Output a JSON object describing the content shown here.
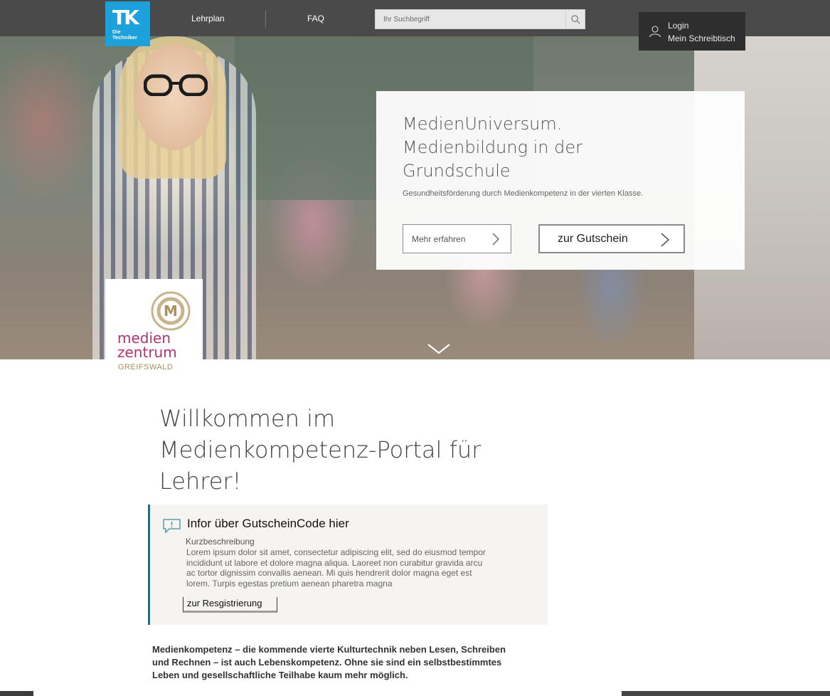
{
  "brand": {
    "logo_mark": "TK",
    "logo_text": "Die Techniker",
    "color": "#1da1dc"
  },
  "nav": {
    "links": [
      {
        "label": "Lehrplan"
      },
      {
        "label": "FAQ"
      }
    ],
    "search": {
      "placeholder": "Ihr Suchbegriff",
      "icon": "search-icon"
    },
    "login": {
      "line1": "Login",
      "line2": "Mein Schreibtisch",
      "icon": "user-icon"
    }
  },
  "hero": {
    "title": "MedienUniversum. Medienbildung in der Grundschule",
    "subtitle": "Gesundheitsförderung durch Medienkompetenz in der vierten Klasse.",
    "more_button": "Mehr erfahren",
    "voucher_button": "zur Gutschein",
    "scroll_icon": "chevron-down-icon"
  },
  "partner_logo": {
    "line1": "medien",
    "line2": "zentrum",
    "line3": "GREIFSWALD",
    "monogram": "M",
    "colors": {
      "text": "#b2336f",
      "gold": "#a9915f"
    }
  },
  "welcome": {
    "heading": "Willkommen im Medienkompetenz-Portal für Lehrer!"
  },
  "info": {
    "title": "Infor über GutscheinCode hier",
    "label": "Kurzbeschreibung",
    "text": "Lorem ipsum dolor sit amet, consectetur adipiscing elit, sed do eiusmod tempor incididunt ut labore et dolore magna aliqua. Laoreet non curabitur gravida arcu ac tortor dignissim convallis aenean. Mi quis hendrerit dolor magna eget est lorem. Turpis egestas pretium aenean pharetra magna",
    "register_button": "zur Resgistrierung",
    "accent": "#1f6f7f"
  },
  "intro": {
    "text": "Medienkompetenz – die kommende vierte Kulturtechnik neben Lesen, Schreiben und Rechnen – ist auch Lebenskompetenz. Ohne sie sind ein selbstbestimmtes Leben und gesellschaftliche Teilhabe kaum mehr möglich."
  }
}
